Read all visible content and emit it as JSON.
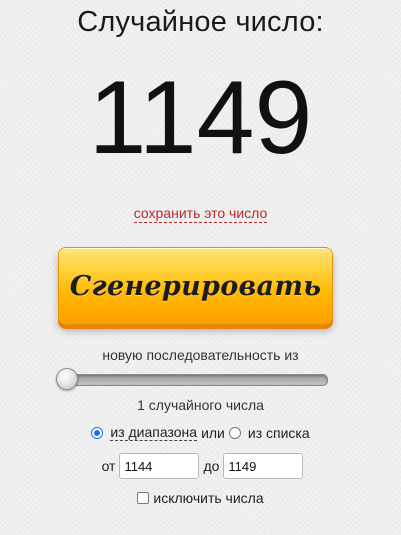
{
  "header": {
    "title": "Случайное число:"
  },
  "result": {
    "value": "1149"
  },
  "actions": {
    "save_link": "сохранить это число",
    "generate_button": "Сгенерировать"
  },
  "sequence": {
    "label": "новую последовательность из",
    "slider_value": 1,
    "count_text": "1 случайного числа"
  },
  "mode": {
    "range_option": "из диапазона",
    "or_text": "или",
    "list_option": "из списка",
    "selected": "range"
  },
  "range": {
    "from_label": "от",
    "from_value": "1144",
    "to_label": "до",
    "to_value": "1149"
  },
  "exclude": {
    "label": "исключить числа",
    "checked": false
  },
  "colors": {
    "link": "#b62a2a",
    "button_top": "#ffd13a",
    "button_bottom": "#ff9f00",
    "radio_active": "#1a73e8"
  }
}
